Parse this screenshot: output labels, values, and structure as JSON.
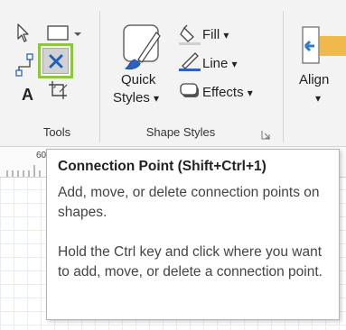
{
  "ribbon": {
    "tools": {
      "group_label": "Tools",
      "pointer_icon": "pointer-arrow-icon",
      "rectangle_icon": "rectangle-dropdown-icon",
      "connector_icon": "connector-icon",
      "connection_point_icon": "connection-point-x-icon",
      "text_icon_glyph": "A",
      "crop_icon": "crop-icon"
    },
    "shape_styles": {
      "group_label": "Shape Styles",
      "quick_styles_label_line1": "Quick",
      "quick_styles_label_line2": "Styles",
      "fill_label": "Fill",
      "line_label": "Line",
      "effects_label": "Effects",
      "dropdown_caret": "▾",
      "launcher_icon": "dialog-launcher-icon"
    },
    "arrange": {
      "align_label": "Align"
    }
  },
  "ruler": {
    "visible_tick_text": "60"
  },
  "tooltip": {
    "title": "Connection Point (Shift+Ctrl+1)",
    "description": "Add, move, or delete connection points on shapes.",
    "hint": "Hold the Ctrl key and click where you want to add, move, or delete a connection point."
  },
  "colors": {
    "highlight_border": "#8dc63f",
    "line_accent_blue": "#2b62c4",
    "align_arrow_blue": "#2b7cd3",
    "align_box_orange": "#f0b94c",
    "ribbon_background": "#f3f3f3"
  }
}
